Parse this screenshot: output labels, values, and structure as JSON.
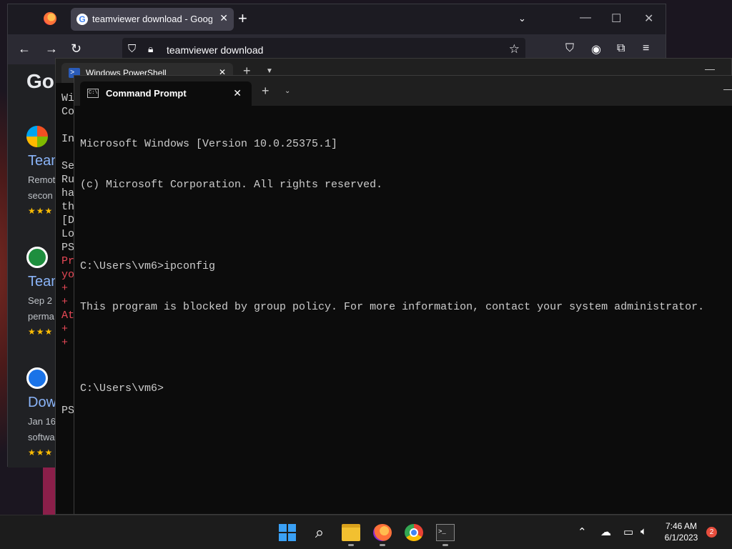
{
  "firefox": {
    "tab_title": "teamviewer download - Google Search",
    "url": "teamviewer download",
    "google_logo": "Goo",
    "results": [
      {
        "title": "Team",
        "line1": "Remot",
        "line2": "secon",
        "stars": "★★★"
      },
      {
        "title": "Team",
        "line1": "Sep 2",
        "line2": "perma",
        "stars": "★★★"
      },
      {
        "title": "Dow",
        "line1": "Jan 16",
        "line2": "softwa",
        "stars": "★★★"
      }
    ]
  },
  "powershell": {
    "tab_title": "Windows PowerShell",
    "lines": [
      {
        "text": "Wi",
        "color": "white"
      },
      {
        "text": "Co",
        "color": "white"
      },
      {
        "text": "",
        "color": "white"
      },
      {
        "text": "In",
        "color": "white"
      },
      {
        "text": "",
        "color": "white"
      },
      {
        "text": "Se",
        "color": "white"
      },
      {
        "text": "Ru",
        "color": "white"
      },
      {
        "text": "ha",
        "color": "white"
      },
      {
        "text": "th",
        "color": "white"
      },
      {
        "text": "[D",
        "color": "white"
      },
      {
        "text": "Lo",
        "color": "white"
      },
      {
        "text": "PS",
        "color": "white"
      },
      {
        "text": "Pr",
        "color": "red"
      },
      {
        "text": "yo",
        "color": "red"
      },
      {
        "text": "+",
        "color": "red"
      },
      {
        "text": "+",
        "color": "red"
      },
      {
        "text": "At",
        "color": "red"
      },
      {
        "text": "+",
        "color": "red"
      },
      {
        "text": "+",
        "color": "red"
      },
      {
        "text": "",
        "color": "white"
      },
      {
        "text": "",
        "color": "white"
      },
      {
        "text": "",
        "color": "white"
      },
      {
        "text": "",
        "color": "white"
      },
      {
        "text": "PS",
        "color": "white"
      }
    ]
  },
  "cmd": {
    "tab_title": "Command Prompt",
    "lines": [
      "Microsoft Windows [Version 10.0.25375.1]",
      "(c) Microsoft Corporation. All rights reserved.",
      "",
      "C:\\Users\\vm6>ipconfig",
      "This program is blocked by group policy. For more information, contact your system administrator.",
      "",
      "C:\\Users\\vm6>"
    ]
  },
  "taskbar": {
    "time": "7:46 AM",
    "date": "6/1/2023",
    "notification_count": "2"
  },
  "colors": {
    "ps_error": "#e74856",
    "accent_windows": "#3aa0f5"
  }
}
